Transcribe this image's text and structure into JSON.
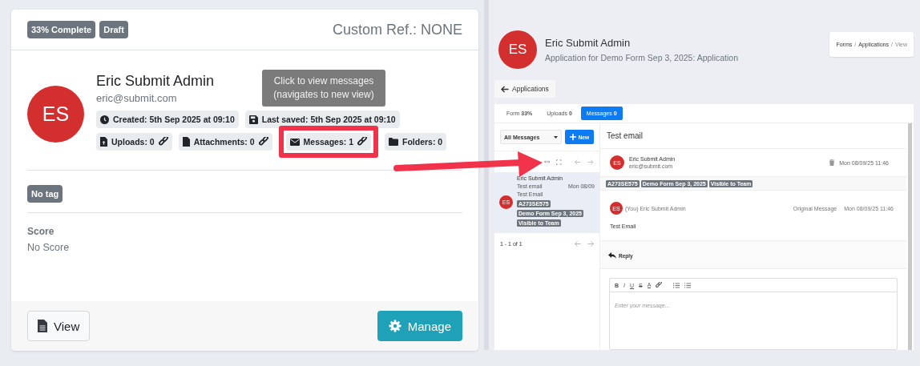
{
  "card": {
    "badges": [
      "33% Complete",
      "Draft"
    ],
    "custom_ref": "Custom Ref.: NONE",
    "avatar": "ES",
    "name": "Eric Submit Admin",
    "email": "eric@submit.com",
    "chip_rows": [
      [
        {
          "kind": "clock",
          "text": "Created: 5th Sep 2025 at 09:10",
          "linked": false,
          "highlighted": false
        },
        {
          "kind": "save",
          "text": "Last saved: 5th Sep 2025 at 09:10",
          "linked": false,
          "highlighted": false
        }
      ],
      [
        {
          "kind": "upload",
          "text": "Uploads: 0",
          "linked": true,
          "highlighted": false
        },
        {
          "kind": "file",
          "text": "Attachments: 0",
          "linked": true,
          "highlighted": false
        },
        {
          "kind": "envelope",
          "text": "Messages: 1",
          "linked": true,
          "highlighted": true
        },
        {
          "kind": "folder",
          "text": "Folders: 0",
          "linked": false,
          "highlighted": false
        }
      ]
    ],
    "tooltip": [
      "Click to view messages",
      "(navigates to new view)"
    ],
    "tag": "No tag",
    "score_label": "Score",
    "score": "No Score",
    "buttons": [
      {
        "kind": "secondary",
        "label": "View"
      },
      {
        "kind": "primary",
        "label": "Manage"
      }
    ]
  },
  "preview": {
    "avatar": "ES",
    "name": "Eric Submit Admin",
    "subtitle": "Application for Demo Form Sep 3, 2025: Application",
    "breadcrumb": [
      {
        "label": "Forms",
        "current": false
      },
      {
        "label": "Applications",
        "current": false
      },
      {
        "label": "View",
        "current": true
      }
    ],
    "separator": "/",
    "back": "Applications",
    "tabs": [
      {
        "label": "Form",
        "count": "33%",
        "selected": false
      },
      {
        "label": "Uploads",
        "count": "0",
        "selected": false
      },
      {
        "label": "Messages",
        "count": "0",
        "selected": true
      }
    ],
    "filter": "All Messages",
    "new_button": "New",
    "list": [
      {
        "name": "Eric Submit Admin",
        "subject": "Test email",
        "date": "Mon 08/09",
        "preview": "Test Email",
        "avatar": "ES",
        "tags": [
          "A273SE575",
          "Demo Form Sep 3, 2025",
          "Visible to Team"
        ],
        "selected": true
      }
    ],
    "pager": "1 - 1 of 1",
    "message": {
      "title": "Test email",
      "avatar": "ES",
      "sender": "Eric Submit Admin",
      "email": "eric@submit.com",
      "date": "Mon 08/09/25 11:46",
      "tags": [
        "A273SE575",
        "Demo Form Sep 3, 2025",
        "Visible to Team"
      ],
      "thread": {
        "avatar": "ES",
        "author": "(You) Eric Submit Admin",
        "label": "Original Message",
        "date": "Mon 08/09/25 11:46",
        "body": "Test Email"
      }
    },
    "reply": "Reply",
    "editor_tools": [
      {
        "kind": "bold",
        "label": "B"
      },
      {
        "kind": "italic",
        "label": "I"
      },
      {
        "kind": "underline",
        "label": "U"
      },
      {
        "kind": "strike",
        "label": "S"
      },
      {
        "kind": "color",
        "label": "A"
      },
      {
        "kind": "link"
      },
      {
        "kind": "ordered-list"
      },
      {
        "kind": "bullet-list"
      }
    ],
    "editor_placeholder": "Enter your message..."
  }
}
